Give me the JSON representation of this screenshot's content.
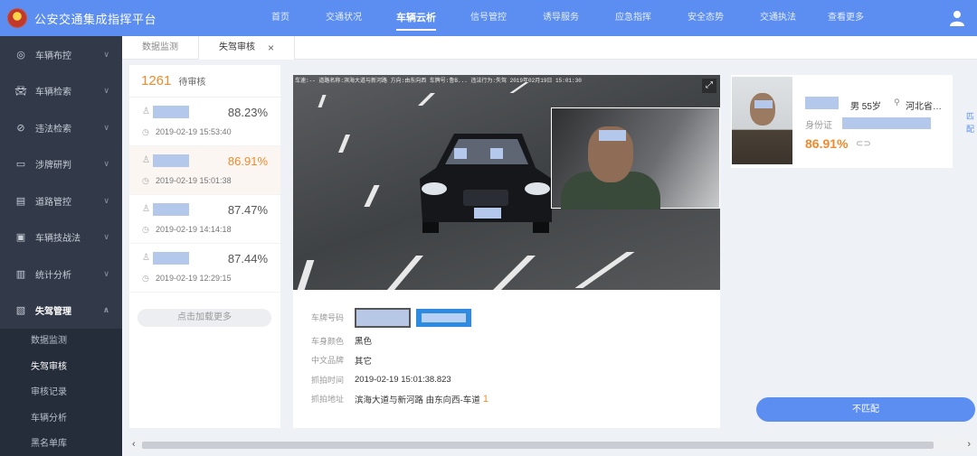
{
  "app": {
    "title": "公安交通集成指挥平台"
  },
  "nav": {
    "items": [
      {
        "label": "首页",
        "width": 60
      },
      {
        "label": "交通状况",
        "width": 80
      },
      {
        "label": "车辆云析",
        "width": 80
      },
      {
        "label": "信号管控",
        "width": 80
      },
      {
        "label": "诱导服务",
        "width": 80
      },
      {
        "label": "应急指挥",
        "width": 80
      },
      {
        "label": "安全态势",
        "width": 80
      },
      {
        "label": "交通执法",
        "width": 80
      },
      {
        "label": "查看更多",
        "width": 70
      }
    ],
    "active_index": 2
  },
  "sidebar": {
    "items": [
      {
        "label": "车辆布控",
        "icon": "target-icon"
      },
      {
        "label": "车辆检索",
        "icon": "car-icon"
      },
      {
        "label": "违法检索",
        "icon": "ban-icon"
      },
      {
        "label": "涉牌研判",
        "icon": "plate-icon"
      },
      {
        "label": "道路管控",
        "icon": "road-icon"
      },
      {
        "label": "车辆技战法",
        "icon": "tactics-icon"
      },
      {
        "label": "统计分析",
        "icon": "chart-icon"
      },
      {
        "label": "失驾管理",
        "icon": "license-icon"
      }
    ],
    "submenu": [
      {
        "label": "数据监测",
        "active": false
      },
      {
        "label": "失驾审核",
        "active": true
      },
      {
        "label": "审核记录",
        "active": false
      },
      {
        "label": "车辆分析",
        "active": false
      },
      {
        "label": "黑名单库",
        "active": false
      }
    ]
  },
  "tabs": [
    {
      "label": "数据监测",
      "active": false
    },
    {
      "label": "失驾审核",
      "active": true,
      "close": "×"
    }
  ],
  "review_list": {
    "count": "1261",
    "count_label": "待审核",
    "items": [
      {
        "pct": "88.23%",
        "time": "2019-02-19 15:53:40",
        "selected": false
      },
      {
        "pct": "86.91%",
        "time": "2019-02-19 15:01:38",
        "selected": true
      },
      {
        "pct": "87.47%",
        "time": "2019-02-19 14:14:18",
        "selected": false
      },
      {
        "pct": "87.44%",
        "time": "2019-02-19 12:29:15",
        "selected": false
      }
    ],
    "load_more": "点击加载更多"
  },
  "capture": {
    "overlay_text": "车速:-- 道路名称:滨海大道与新河路 方向:由东向西 车牌号:鲁B... 违法行为:失驾 2019年02月19日 15:01:30",
    "fields": {
      "plate_label": "车牌号码",
      "color_label": "车身颜色",
      "color_value": "黑色",
      "brand_label": "中文品牌",
      "brand_value": "其它",
      "time_label": "抓拍时间",
      "time_value": "2019-02-19 15:01:38.823",
      "addr_label": "抓拍地址",
      "addr_value": "滨海大道与新河路  由东向西-车道",
      "lane_value": "1"
    }
  },
  "match": {
    "gender_age": "男  55岁",
    "region": "河北省…",
    "id_label": "身份证",
    "pct": "86.91%",
    "edge_text": "匹配"
  },
  "actions": {
    "no_match": "不匹配"
  },
  "colors": {
    "primary": "#5b8ef0",
    "accent": "#f08a2c",
    "sidebar": "#323a4a"
  }
}
